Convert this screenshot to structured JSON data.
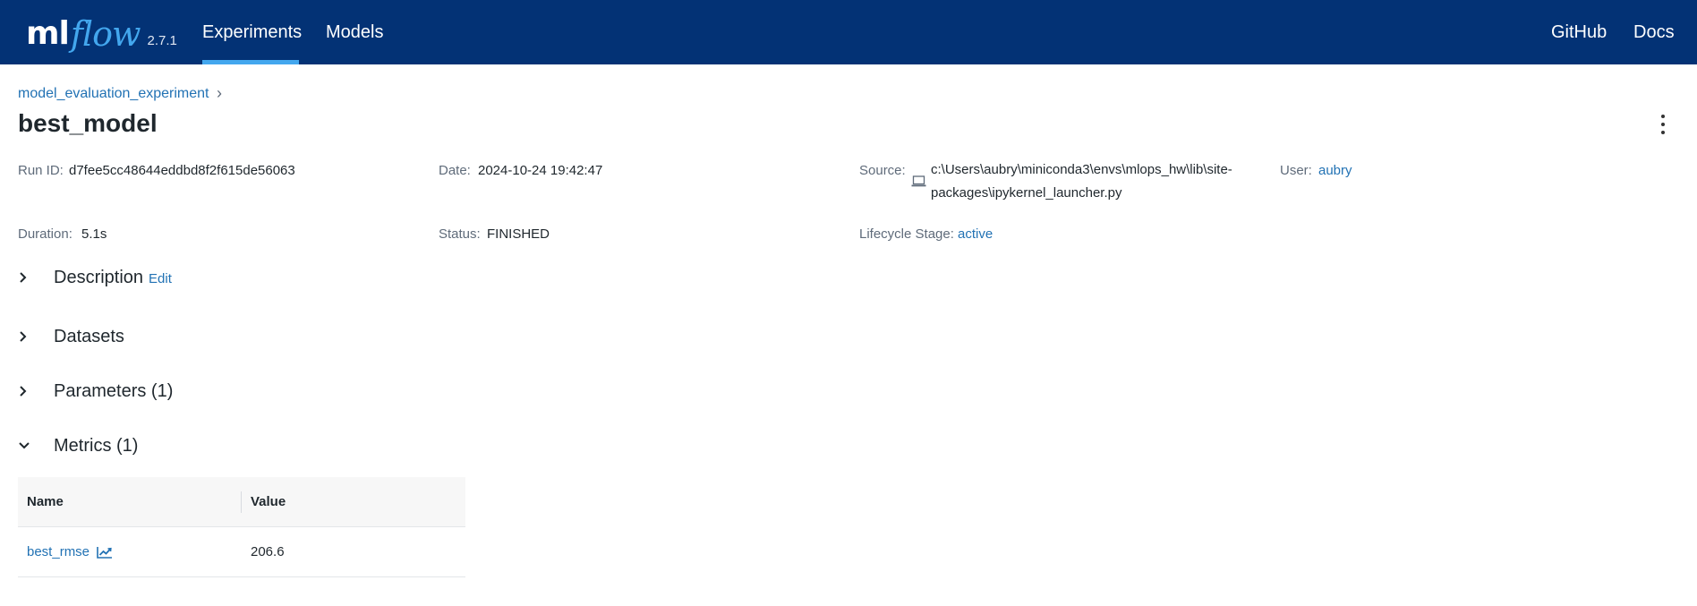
{
  "app": {
    "logo_ml": "ml",
    "logo_flow": "flow",
    "version": "2.7.1"
  },
  "nav": {
    "experiments": "Experiments",
    "models": "Models",
    "github": "GitHub",
    "docs": "Docs"
  },
  "breadcrumb": {
    "experiment": "model_evaluation_experiment",
    "separator": "›"
  },
  "run": {
    "name": "best_model",
    "run_id_label": "Run ID:",
    "run_id": "d7fee5cc48644eddbd8f2f615de56063",
    "date_label": "Date:",
    "date": "2024-10-24 19:42:47",
    "source_label": "Source:",
    "source_line1": "c:\\Users\\aubry\\miniconda3\\envs\\mlops_hw\\lib\\site-",
    "source_line2": "packages\\ipykernel_launcher.py",
    "user_label": "User:",
    "user": "aubry",
    "duration_label": "Duration:",
    "duration": "5.1s",
    "status_label": "Status:",
    "status": "FINISHED",
    "lifecycle_label": "Lifecycle Stage:",
    "lifecycle": "active"
  },
  "sections": {
    "description": "Description",
    "description_edit": "Edit",
    "datasets": "Datasets",
    "parameters": "Parameters (1)",
    "metrics": "Metrics (1)"
  },
  "metrics_table": {
    "columns": [
      "Name",
      "Value"
    ],
    "rows": [
      {
        "name": "best_rmse",
        "value": "206.6"
      }
    ]
  },
  "icons": {
    "source": "laptop-icon",
    "metric_chart": "line-chart-icon",
    "menu": "kebab-menu-icon"
  },
  "colors": {
    "header_bg": "#033275",
    "accent": "#43a7ee",
    "link": "#2272b4"
  }
}
